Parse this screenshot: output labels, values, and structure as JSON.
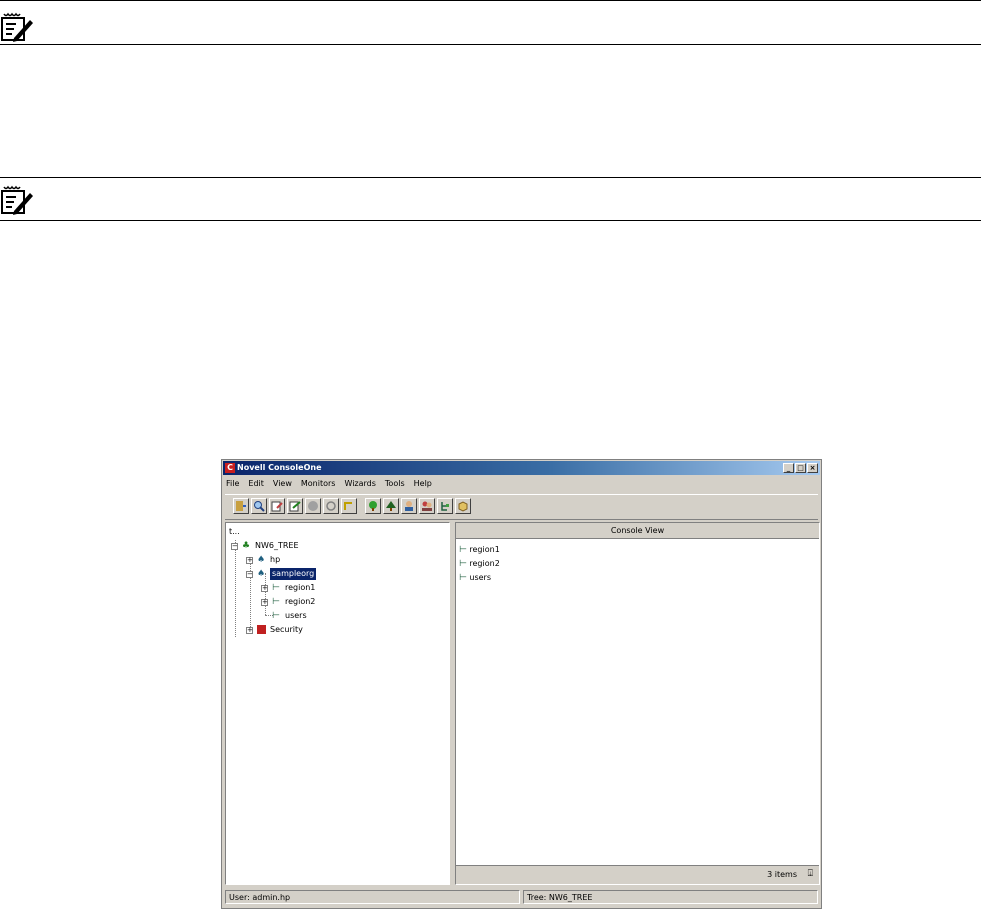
{
  "window": {
    "title": "Novell ConsoleOne",
    "title_icon": "C",
    "controls": {
      "minimize": "_",
      "maximize": "□",
      "close": "×"
    }
  },
  "menu": [
    {
      "label": "File"
    },
    {
      "label": "Edit"
    },
    {
      "label": "View"
    },
    {
      "label": "Monitors"
    },
    {
      "label": "Wizards"
    },
    {
      "label": "Tools"
    },
    {
      "label": "Help"
    }
  ],
  "toolbar_icons": [
    "exit-icon",
    "find-icon",
    "properties-icon",
    "edit-icon",
    "stop-icon",
    "refresh-icon",
    "up-icon",
    "create-icon",
    "tree-icon",
    "user-icon",
    "group-icon",
    "ou-icon",
    "package-icon"
  ],
  "tree": {
    "root_glyph": "t...",
    "nodes": {
      "tree_root": "NW6_TREE",
      "hp": "hp",
      "sampleorg": "sampleorg",
      "region1": "region1",
      "region2": "region2",
      "users": "users",
      "security": "Security"
    }
  },
  "console_view": {
    "header": "Console View",
    "items": [
      "region1",
      "region2",
      "users"
    ],
    "count": "3 items"
  },
  "status": {
    "user": "User: admin.hp",
    "tree": "Tree: NW6_TREE"
  },
  "colors": {
    "selection": "#0a246a",
    "window_face": "#d4d0c8",
    "title_gradient_start": "#0a246a"
  }
}
